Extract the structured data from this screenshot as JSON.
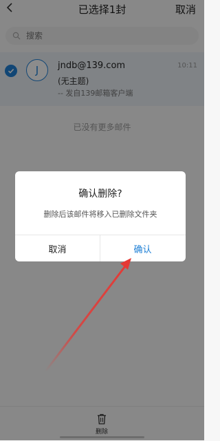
{
  "header": {
    "title": "已选择1封",
    "cancel_label": "取消"
  },
  "search": {
    "placeholder": "搜索"
  },
  "mail_item": {
    "avatar_letter": "J",
    "sender": "jndb@139.com",
    "time": "10:11",
    "subject": "(无主题)",
    "preview": "-- 发自139邮箱客户端"
  },
  "list": {
    "end_text": "已没有更多邮件"
  },
  "toolbar": {
    "delete_label": "删除"
  },
  "dialog": {
    "title": "确认删除?",
    "message": "删除后该邮件将移入已删除文件夹",
    "cancel_label": "取消",
    "confirm_label": "确认"
  },
  "colors": {
    "accent": "#1f80d6",
    "annotation": "#e53935"
  }
}
